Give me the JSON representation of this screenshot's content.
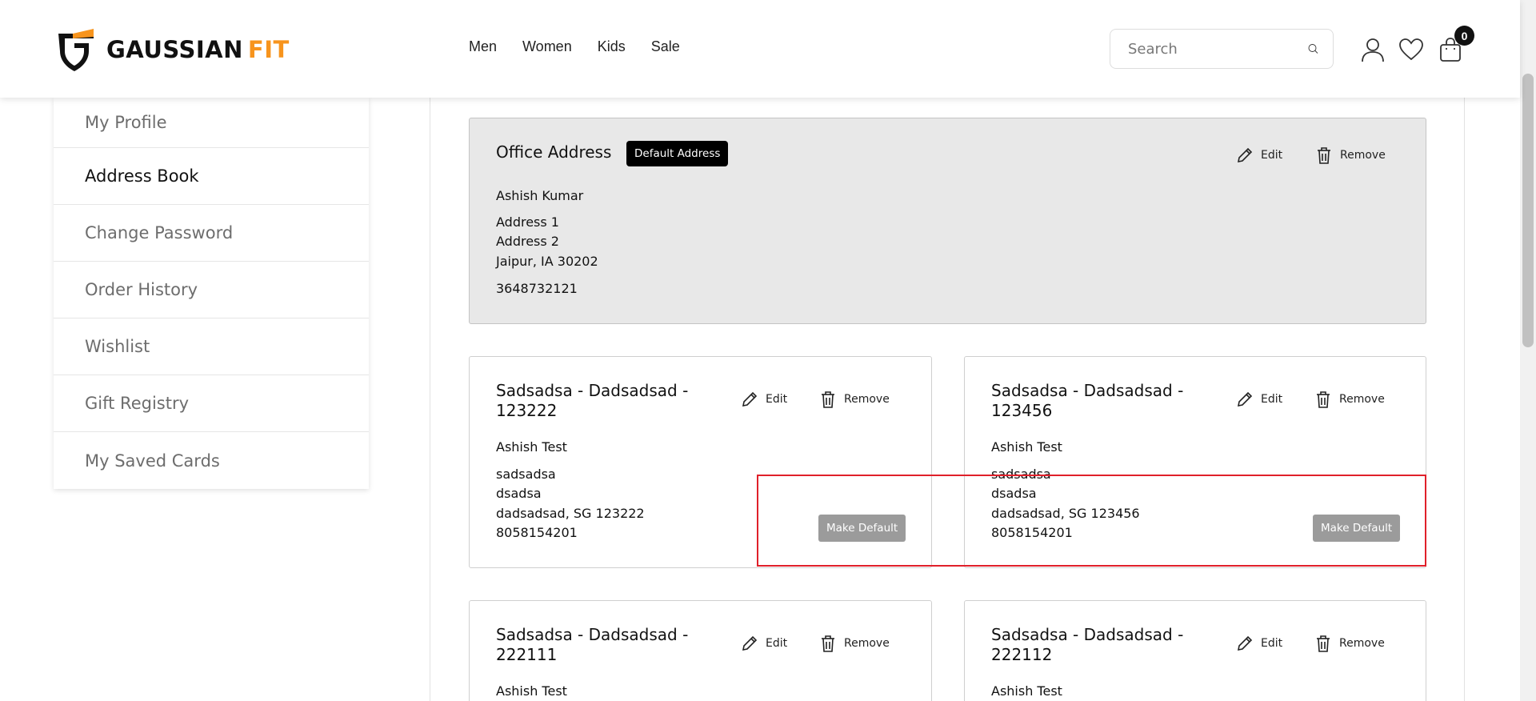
{
  "brand": {
    "name_part1": "GAUSSIAN",
    "name_part2": "FIT",
    "accent": "#f7941d"
  },
  "nav": {
    "items": [
      "Men",
      "Women",
      "Kids",
      "Sale"
    ]
  },
  "search": {
    "placeholder": "Search"
  },
  "header_icons": [
    "user-icon",
    "heart-icon",
    "cart-icon"
  ],
  "cart": {
    "count": "0"
  },
  "sidebar": {
    "items": [
      {
        "label": "My Profile"
      },
      {
        "label": "Address Book",
        "active": true
      },
      {
        "label": "Change Password"
      },
      {
        "label": "Order History"
      },
      {
        "label": "Wishlist"
      },
      {
        "label": "Gift Registry"
      },
      {
        "label": "My Saved Cards"
      }
    ]
  },
  "addresses": {
    "default": {
      "title": "Office Address",
      "badge": "Default Address",
      "name": "Ashish Kumar",
      "line1": "Address 1",
      "line2": "Address 2",
      "city": "Jaipur, IA 30202",
      "phone": "3648732121"
    },
    "cards": [
      {
        "title_l1": "Sadsadsa - Dadsadsad -",
        "title_l2": "123222",
        "name": "Ashish Test",
        "line1": "sadsadsa",
        "line2": "dsadsa",
        "city": "dadsadsad, SG 123222",
        "phone": "8058154201"
      },
      {
        "title_l1": "Sadsadsa - Dadsadsad -",
        "title_l2": "123456",
        "name": "Ashish Test",
        "line1": "sadsadsa",
        "line2": "dsadsa",
        "city": "dadsadsad, SG 123456",
        "phone": "8058154201"
      },
      {
        "title_l1": "Sadsadsa - Dadsadsad -",
        "title_l2": "222111",
        "name": "Ashish Test"
      },
      {
        "title_l1": "Sadsadsa - Dadsadsad -",
        "title_l2": "222112",
        "name": "Ashish Test"
      }
    ]
  },
  "actions": {
    "edit": "Edit",
    "remove": "Remove",
    "make_default": "Make Default"
  }
}
